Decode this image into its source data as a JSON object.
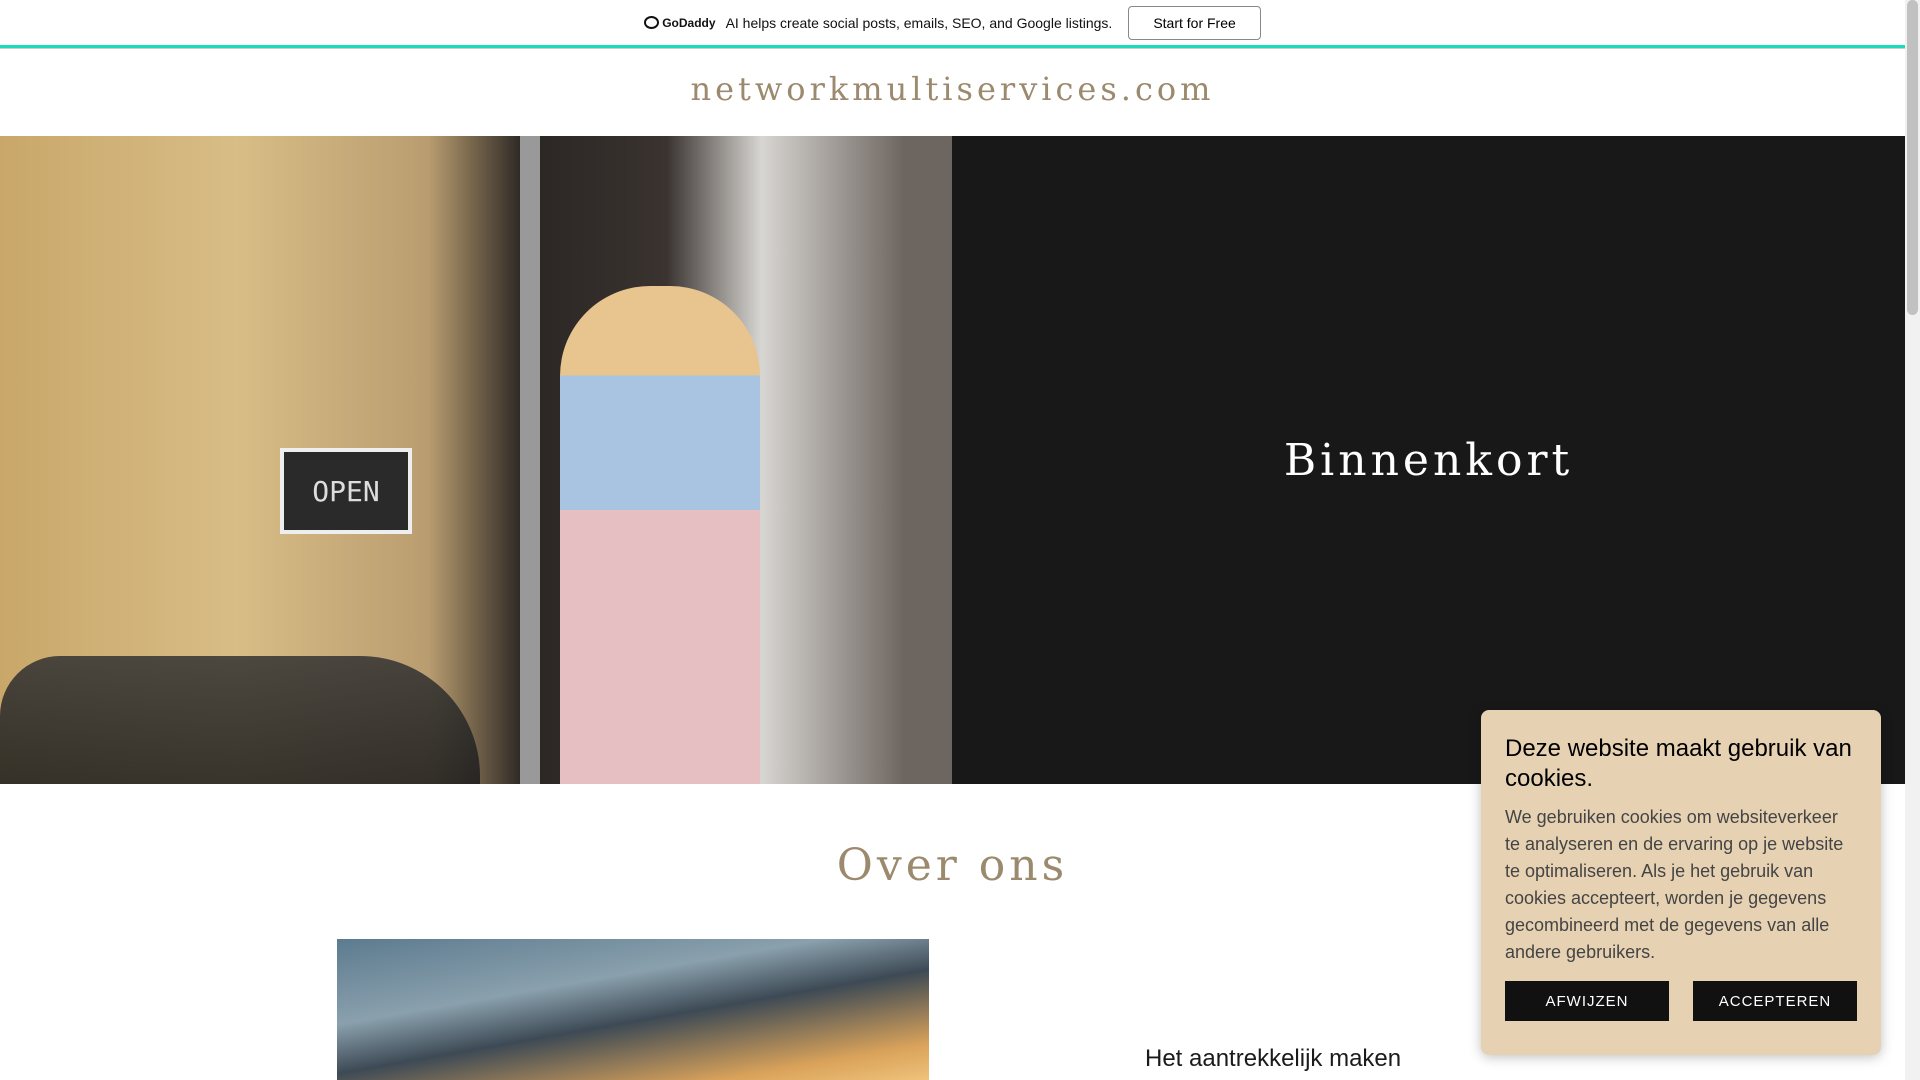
{
  "promo": {
    "brand": "GoDaddy",
    "text": "AI helps create social posts, emails, SEO, and Google listings.",
    "button": "Start for Free"
  },
  "site": {
    "title": "networkmultiservices.com"
  },
  "hero": {
    "photo_sign": "OPEN",
    "heading": "Binnenkort"
  },
  "about": {
    "heading": "Over ons",
    "feature_title": "Het aantrekkelijk maken"
  },
  "cookie": {
    "title": "Deze website maakt gebruik van cookies.",
    "body": "We gebruiken cookies om websiteverkeer te analyseren en de ervaring op je website te optimaliseren. Als je het gebruik van cookies accepteert, worden je gegevens gecombineerd met de gegevens van alle andere gebruikers.",
    "decline": "AFWIJZEN",
    "accept": "ACCEPTEREN"
  }
}
